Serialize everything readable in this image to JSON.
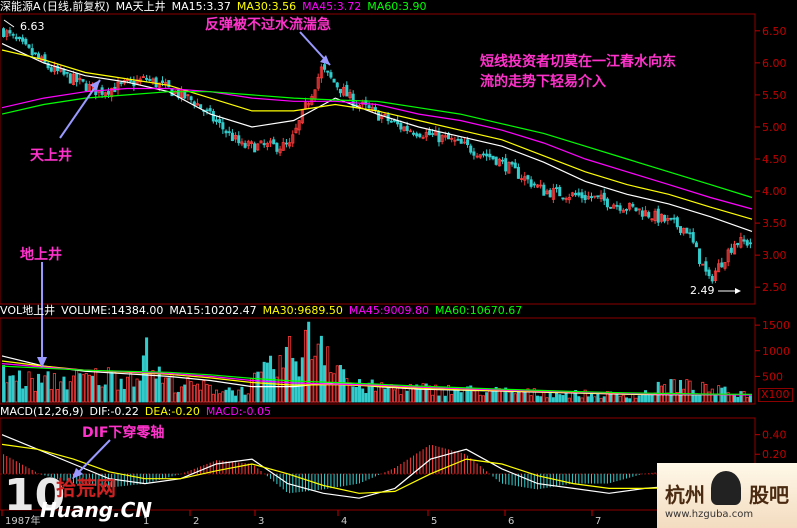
{
  "header": {
    "stock": "深能源A",
    "mode": "(日线,前复权)",
    "indicator": "MA天上井",
    "ma15": "MA15:3.37",
    "ma30": "MA30:3.56",
    "ma45": "MA45:3.72",
    "ma60": "MA60:3.90"
  },
  "vol_header": {
    "label": "VOL地上井",
    "volume": "VOLUME:14384.00",
    "ma15": "MA15:10202.47",
    "ma30": "MA30:9689.50",
    "ma45": "MA45:9009.80",
    "ma60": "MA60:10670.67"
  },
  "macd_header": {
    "label": "MACD(12,26,9)",
    "dif": "DIF:-0.22",
    "dea": "DEA:-0.20",
    "macd": "MACD:-0.05"
  },
  "annotations": {
    "rebound": "反弹被不过水流湍急",
    "advice_line1": "短线投资者切莫在一江春水向东",
    "advice_line2": "流的走势下轻易介入",
    "tianshangjing": "天上井",
    "dishangjing": "地上井",
    "dif_cross": "DIF下穿零轴"
  },
  "price_marks": {
    "high": "6.63",
    "low": "2.49"
  },
  "vol_unit": "X100",
  "watermarks": {
    "left_site": "Huang.CN",
    "left_cn": "拾荒网",
    "right_cn1": "杭州",
    "right_cn2": "股吧",
    "right_site": "www.hzguba.com"
  },
  "colors": {
    "up": "#ff3b3b",
    "down": "#33cccc",
    "ma15": "#ffffff",
    "ma30": "#ffff00",
    "ma45": "#ff00ff",
    "ma60": "#00ff00",
    "axis": "#c00000",
    "annotation": "#ff33cc",
    "arrow": "#9999ff"
  },
  "chart_data": [
    {
      "type": "candlestick",
      "panel": "price",
      "ylim": [
        2.3,
        6.7
      ],
      "yticks": [
        2.5,
        3.0,
        3.5,
        4.0,
        4.5,
        5.0,
        5.5,
        6.0,
        6.5
      ],
      "xticks": [
        "1987年",
        "1",
        "2",
        "3",
        "4",
        "5",
        "6",
        "7"
      ],
      "ohlc_key_points": [
        {
          "i": 0,
          "close": 6.5
        },
        {
          "i": 15,
          "close": 5.9
        },
        {
          "i": 30,
          "close": 5.55
        },
        {
          "i": 45,
          "close": 5.75
        },
        {
          "i": 60,
          "close": 5.4
        },
        {
          "i": 75,
          "close": 4.7
        },
        {
          "i": 90,
          "close": 4.7
        },
        {
          "i": 100,
          "close": 5.9
        },
        {
          "i": 110,
          "close": 5.4
        },
        {
          "i": 125,
          "close": 5.0
        },
        {
          "i": 140,
          "close": 4.8
        },
        {
          "i": 155,
          "close": 4.5
        },
        {
          "i": 170,
          "close": 4.0
        },
        {
          "i": 185,
          "close": 3.9
        },
        {
          "i": 200,
          "close": 3.7
        },
        {
          "i": 215,
          "close": 3.4
        },
        {
          "i": 222,
          "close": 2.6
        },
        {
          "i": 230,
          "close": 3.2
        }
      ],
      "series": [
        {
          "name": "MA15",
          "values": [
            6.3,
            6.0,
            5.8,
            5.7,
            5.55,
            5.2,
            5.0,
            5.1,
            5.45,
            5.2,
            5.0,
            4.85,
            4.7,
            4.45,
            4.15,
            3.95,
            3.8,
            3.6,
            3.37
          ]
        },
        {
          "name": "MA30",
          "values": [
            6.2,
            6.05,
            5.85,
            5.75,
            5.65,
            5.45,
            5.25,
            5.25,
            5.35,
            5.25,
            5.1,
            4.95,
            4.8,
            4.55,
            4.3,
            4.1,
            3.95,
            3.75,
            3.56
          ]
        },
        {
          "name": "MA45",
          "values": [
            5.3,
            5.45,
            5.55,
            5.6,
            5.6,
            5.55,
            5.45,
            5.4,
            5.4,
            5.35,
            5.2,
            5.1,
            4.95,
            4.75,
            4.5,
            4.3,
            4.1,
            3.9,
            3.72
          ]
        },
        {
          "name": "MA60",
          "values": [
            5.2,
            5.35,
            5.45,
            5.5,
            5.55,
            5.55,
            5.5,
            5.45,
            5.42,
            5.4,
            5.3,
            5.2,
            5.05,
            4.9,
            4.7,
            4.5,
            4.3,
            4.1,
            3.9
          ]
        }
      ]
    },
    {
      "type": "bar",
      "panel": "volume",
      "ylim": [
        0,
        1600
      ],
      "yticks": [
        500,
        1000,
        1500
      ],
      "volume_key_points": [
        {
          "i": 0,
          "v": 600
        },
        {
          "i": 10,
          "v": 450
        },
        {
          "i": 20,
          "v": 500
        },
        {
          "i": 30,
          "v": 550
        },
        {
          "i": 40,
          "v": 600
        },
        {
          "i": 45,
          "v": 1000
        },
        {
          "i": 50,
          "v": 500
        },
        {
          "i": 60,
          "v": 350
        },
        {
          "i": 75,
          "v": 250
        },
        {
          "i": 100,
          "v": 1500
        },
        {
          "i": 110,
          "v": 350
        },
        {
          "i": 130,
          "v": 300
        },
        {
          "i": 150,
          "v": 250
        },
        {
          "i": 170,
          "v": 200
        },
        {
          "i": 200,
          "v": 150
        },
        {
          "i": 210,
          "v": 400
        },
        {
          "i": 230,
          "v": 200
        }
      ],
      "series": [
        {
          "name": "MA15",
          "values": [
            900,
            700,
            600,
            550,
            500,
            420,
            300,
            300,
            380,
            300,
            250,
            230,
            210,
            190,
            170,
            150,
            140,
            140,
            143
          ]
        },
        {
          "name": "MA30",
          "values": [
            800,
            700,
            620,
            580,
            540,
            470,
            380,
            330,
            340,
            310,
            270,
            240,
            220,
            200,
            180,
            160,
            150,
            145,
            140
          ]
        },
        {
          "name": "MA45",
          "values": [
            750,
            680,
            620,
            590,
            560,
            500,
            420,
            370,
            350,
            330,
            290,
            260,
            235,
            210,
            190,
            170,
            155,
            145,
            136
          ]
        },
        {
          "name": "MA60",
          "values": [
            700,
            660,
            620,
            600,
            580,
            530,
            460,
            410,
            380,
            350,
            310,
            280,
            250,
            225,
            200,
            180,
            165,
            155,
            150
          ]
        }
      ]
    },
    {
      "type": "line",
      "panel": "macd",
      "ylim": [
        -0.35,
        0.55
      ],
      "yticks": [
        0.2,
        0.4
      ],
      "series": [
        {
          "name": "DIF",
          "values": [
            0.4,
            0.25,
            0.1,
            -0.05,
            -0.1,
            -0.05,
            0.1,
            0.15,
            -0.1,
            -0.2,
            -0.25,
            -0.15,
            0.15,
            0.25,
            0.05,
            -0.1,
            -0.15,
            -0.2,
            -0.15,
            -0.12,
            -0.18,
            -0.22
          ]
        },
        {
          "name": "DEA",
          "values": [
            0.3,
            0.25,
            0.15,
            0.02,
            -0.05,
            -0.05,
            0.03,
            0.1,
            0.0,
            -0.12,
            -0.2,
            -0.18,
            0.0,
            0.15,
            0.1,
            -0.02,
            -0.1,
            -0.15,
            -0.15,
            -0.14,
            -0.16,
            -0.2
          ]
        }
      ]
    }
  ]
}
